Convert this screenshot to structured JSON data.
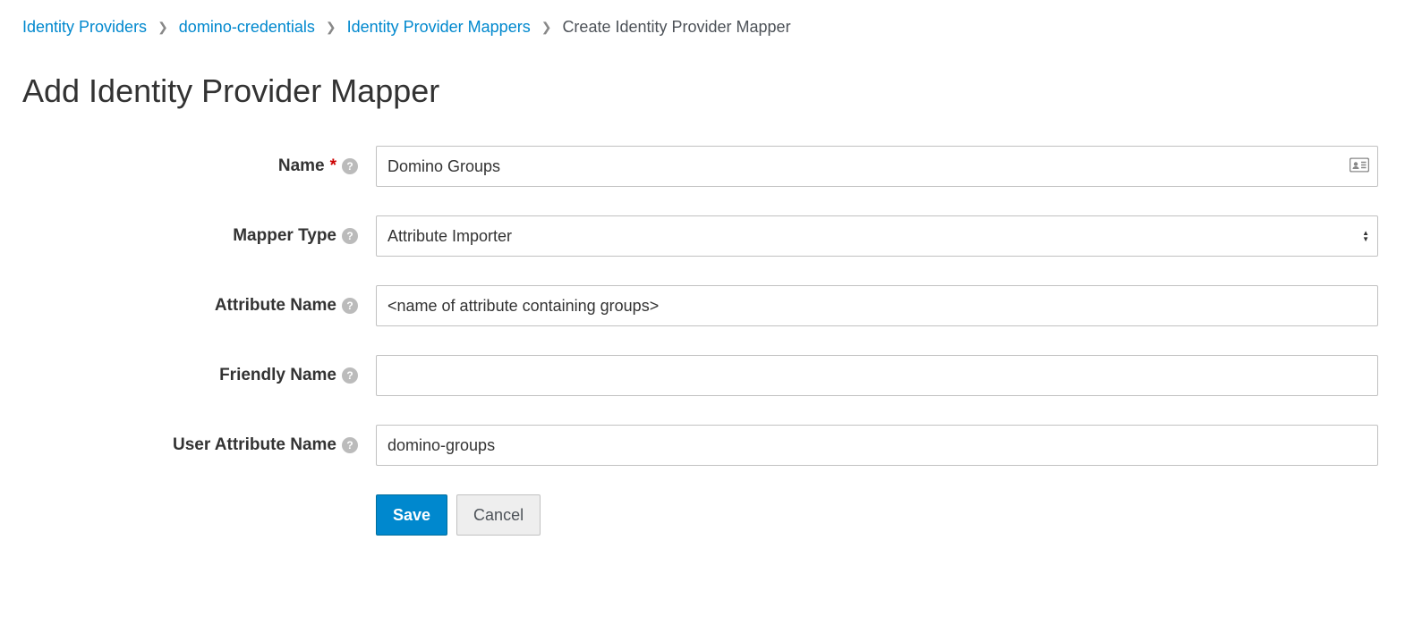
{
  "breadcrumb": {
    "items": [
      {
        "label": "Identity Providers",
        "link": true
      },
      {
        "label": "domino-credentials",
        "link": true
      },
      {
        "label": "Identity Provider Mappers",
        "link": true
      },
      {
        "label": "Create Identity Provider Mapper",
        "link": false
      }
    ]
  },
  "page": {
    "title": "Add Identity Provider Mapper"
  },
  "form": {
    "name": {
      "label": "Name",
      "required": true,
      "value": "Domino Groups"
    },
    "mapper_type": {
      "label": "Mapper Type",
      "value": "Attribute Importer"
    },
    "attribute_name": {
      "label": "Attribute Name",
      "value": "<name of attribute containing groups>"
    },
    "friendly_name": {
      "label": "Friendly Name",
      "value": ""
    },
    "user_attribute_name": {
      "label": "User Attribute Name",
      "value": "domino-groups"
    }
  },
  "buttons": {
    "save": "Save",
    "cancel": "Cancel"
  }
}
